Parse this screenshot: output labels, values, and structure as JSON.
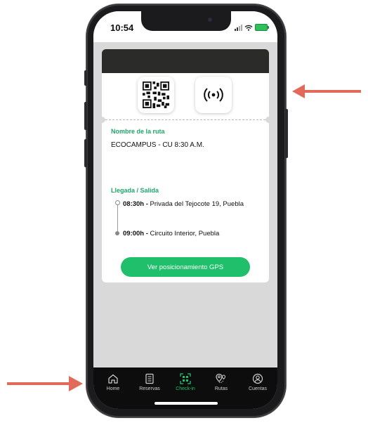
{
  "status_bar": {
    "time": "10:54",
    "icons": [
      "signal-icon",
      "wifi-icon",
      "battery-charging-icon"
    ],
    "battery_color": "#2fbf5a"
  },
  "card": {
    "icons": [
      "qr-code-icon",
      "nfc-broadcast-icon"
    ],
    "route_label": "Nombre de la ruta",
    "route_name": "ECOCAMPUS - CU 8:30 A.M.",
    "schedule_label": "Llegada / Salida",
    "stops": [
      {
        "time": "08:30h -",
        "place": "Privada del Tejocote 19, Puebla"
      },
      {
        "time": "09:00h -",
        "place": "Circuito Interior, Puebla"
      }
    ],
    "gps_button": "Ver posicionamiento GPS"
  },
  "tabbar": {
    "items": [
      {
        "label": "Home",
        "icon": "home-icon",
        "active": false
      },
      {
        "label": "Reservas",
        "icon": "document-icon",
        "active": false
      },
      {
        "label": "Check-in",
        "icon": "qr-scan-icon",
        "active": true
      },
      {
        "label": "Rutas",
        "icon": "map-pin-icon",
        "active": false
      },
      {
        "label": "Cuentas",
        "icon": "user-icon",
        "active": false
      }
    ]
  },
  "colors": {
    "accent": "#1fbf6b",
    "arrow": "#e26a5a",
    "card_header": "#2b2b2a"
  }
}
